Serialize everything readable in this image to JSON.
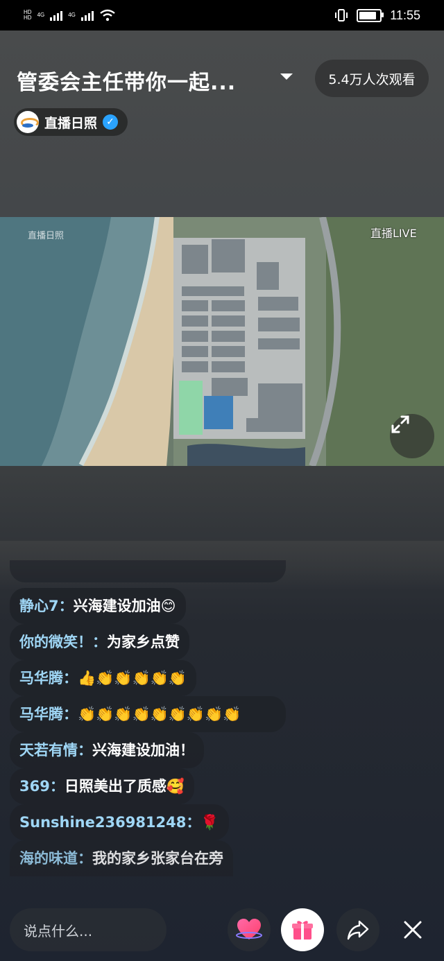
{
  "status_bar": {
    "left_text": "HD 4G 4G",
    "time": "11:55",
    "battery_level": 0.85
  },
  "header": {
    "title": "管委会主任带你一起...",
    "viewers": "5.4万人次观看",
    "channel_name": "直播日照"
  },
  "video": {
    "watermark": "直播日照",
    "live_badge": "直播LIVE"
  },
  "comments": [
    {
      "user": "静心7：",
      "text": "兴海建设加油😊"
    },
    {
      "user": "你的微笑！：",
      "text": "为家乡点赞"
    },
    {
      "user": "马华腾：",
      "text": "👍👏👏👏👏👏"
    },
    {
      "user": "马华腾：",
      "text": "👏👏👏👏👏👏👏👏👏"
    },
    {
      "user": "天若有情：",
      "text": "兴海建设加油！"
    },
    {
      "user": "369：",
      "text": "日照美出了质感🥰"
    },
    {
      "user": "Sunshine236981248：",
      "text": "🌹"
    },
    {
      "user": "海的味道：",
      "text": "我的家乡张家台在旁"
    }
  ],
  "bottom_bar": {
    "input_placeholder": "说点什么...",
    "icons": [
      "heart-icon",
      "gift-icon",
      "share-icon",
      "close-icon"
    ]
  },
  "colors": {
    "username": "#9fd6f5",
    "live_green": "#1fae52",
    "gift_pink": "#ff4f8a"
  }
}
